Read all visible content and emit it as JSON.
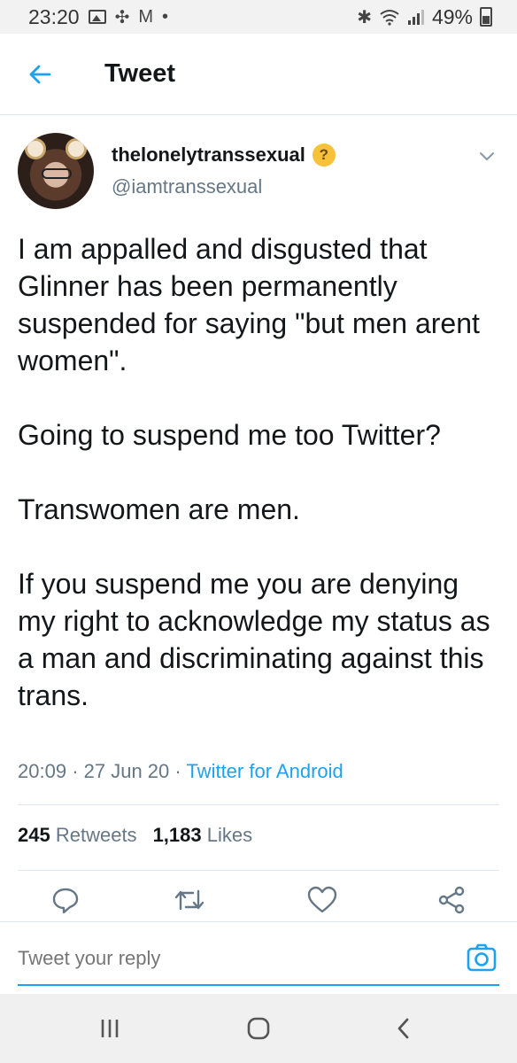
{
  "status_bar": {
    "time": "23:20",
    "carrier_icon": "M",
    "battery": "49%"
  },
  "header": {
    "title": "Tweet"
  },
  "tweet": {
    "display_name": "thelonelytranssexual",
    "emoji": "thinking-face",
    "handle": "@iamtranssexual",
    "text": "I am appalled and disgusted that Glinner has been permanently suspended for saying \"but men arent women\".\n\nGoing to suspend me too Twitter?\n\nTranswomen are men.\n\nIf you suspend me you are denying my right to acknowledge my status as a man and discriminating against this trans.",
    "time": "20:09",
    "date": "27 Jun 20",
    "client": "Twitter for Android",
    "retweets_count": "245",
    "retweets_label": "Retweets",
    "likes_count": "1,183",
    "likes_label": "Likes"
  },
  "reply": {
    "placeholder": "Tweet your reply"
  },
  "colors": {
    "accent": "#1da1f2",
    "muted": "#657786",
    "text": "#14171a",
    "divider": "#e1e8ed"
  }
}
